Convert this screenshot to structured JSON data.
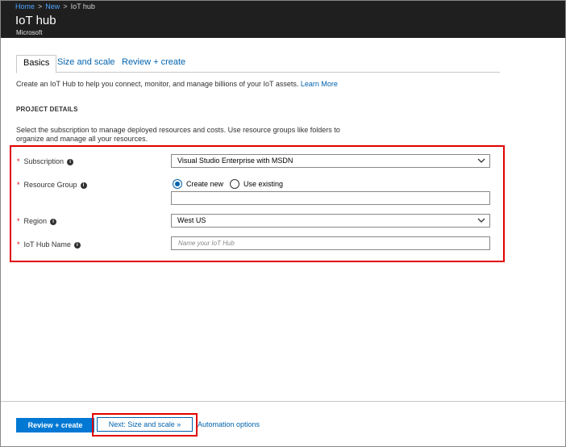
{
  "breadcrumb": {
    "items": [
      "Home",
      "New",
      "IoT hub"
    ]
  },
  "header": {
    "title": "IoT hub",
    "subtitle": "Microsoft"
  },
  "tabs": [
    {
      "label": "Basics",
      "active": true
    },
    {
      "label": "Size and scale",
      "active": false
    },
    {
      "label": "Review + create",
      "active": false
    }
  ],
  "intro": {
    "text": "Create an IoT Hub to help you connect, monitor, and manage billions of your IoT assets.",
    "link": "Learn More"
  },
  "project_details": {
    "heading": "PROJECT DETAILS",
    "description": "Select the subscription to manage deployed resources and costs. Use resource groups like folders to organize and manage all your resources."
  },
  "form": {
    "subscription": {
      "label": "Subscription",
      "value": "Visual Studio Enterprise with MSDN"
    },
    "resource_group": {
      "label": "Resource Group",
      "option_new": "Create new",
      "option_existing": "Use existing",
      "selected": "Create new",
      "value": ""
    },
    "region": {
      "label": "Region",
      "value": "West US"
    },
    "hub_name": {
      "label": "IoT Hub Name",
      "placeholder": "Name your IoT Hub",
      "value": ""
    }
  },
  "footer": {
    "review_button": "Review + create",
    "next_button": "Next: Size and scale »",
    "automation_link": "Automation options"
  },
  "colors": {
    "accent": "#0078d4",
    "link": "#0062ad",
    "highlight": "#e00000",
    "header_bg": "#1f1f1f"
  }
}
